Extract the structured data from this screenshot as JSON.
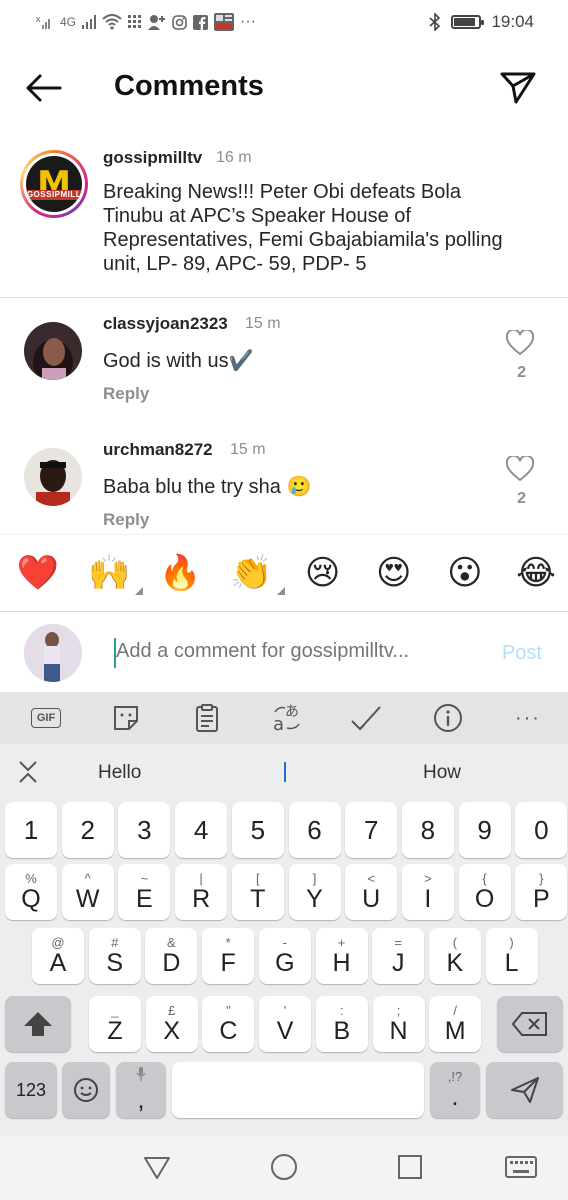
{
  "status_bar": {
    "network": "4G",
    "time": "19:04",
    "battery_level": 0.8,
    "icons": [
      "signal-x-icon",
      "signal-icon",
      "wifi-icon",
      "grid-icon",
      "person-add-icon",
      "instagram-icon",
      "facebook-icon",
      "news-icon",
      "more-dots-icon",
      "bluetooth-icon",
      "battery-icon"
    ]
  },
  "header": {
    "title": "Comments",
    "back_icon": "arrow-left-icon",
    "share_icon": "paper-plane-icon"
  },
  "caption": {
    "username": "gossipmilltv",
    "time": "16 m",
    "text": "Breaking News!!! Peter Obi defeats Bola Tinubu at APC’s Speaker House of Representatives, Femi Gbajabiamila's polling unit, LP- 89, APC- 59, PDP- 5",
    "logo_letter": "M",
    "logo_text": "GOSSIPMILL"
  },
  "comments": [
    {
      "username": "classyjoan2323",
      "time": "15 m",
      "text": "God is with us✔️",
      "reply": "Reply",
      "likes": "2"
    },
    {
      "username": "urchman8272",
      "time": "15 m",
      "text": "Baba blu the try sha 🥲",
      "reply": "Reply",
      "likes": "2"
    }
  ],
  "emojis": [
    "❤️",
    "🙌",
    "🔥",
    "👏",
    "😢",
    "😍",
    "😮",
    "😂"
  ],
  "input": {
    "placeholder": "Add a comment for gossipmilltv...",
    "post": "Post"
  },
  "keyboard_toolbar": {
    "gif": "GIF",
    "items": [
      "gif-icon",
      "sticker-icon",
      "clipboard-icon",
      "translate-icon",
      "handwriting-icon",
      "info-icon",
      "more-icon"
    ]
  },
  "suggestions": {
    "left": "Hello",
    "right": "How"
  },
  "keyboard": {
    "numbers": [
      "1",
      "2",
      "3",
      "4",
      "5",
      "6",
      "7",
      "8",
      "9",
      "0"
    ],
    "row1": [
      [
        "%",
        "Q"
      ],
      [
        "^",
        "W"
      ],
      [
        "~",
        "E"
      ],
      [
        "|",
        "R"
      ],
      [
        "[",
        "T"
      ],
      [
        "]",
        "Y"
      ],
      [
        "<",
        "U"
      ],
      [
        ">",
        "I"
      ],
      [
        "{",
        "O"
      ],
      [
        "}",
        "P"
      ]
    ],
    "row2": [
      [
        "@",
        "A"
      ],
      [
        "#",
        "S"
      ],
      [
        "&",
        "D"
      ],
      [
        "*",
        "F"
      ],
      [
        "-",
        "G"
      ],
      [
        "+",
        "H"
      ],
      [
        "=",
        "J"
      ],
      [
        "(",
        "K"
      ],
      [
        ")",
        "L"
      ]
    ],
    "row3": [
      [
        "_",
        "Z"
      ],
      [
        "£",
        "X"
      ],
      [
        "\"",
        "C"
      ],
      [
        "'",
        "V"
      ],
      [
        ":",
        "B"
      ],
      [
        ";",
        "N"
      ],
      [
        "/",
        "M"
      ]
    ],
    "num_switch": "123",
    "comma": ",",
    "period": ".",
    "period_sub": ",!?"
  },
  "colors": {
    "accent": "#0095f6",
    "post_disabled": "#b2dffc",
    "muted": "#8e8e8e",
    "caret": "#2a9d8f"
  }
}
